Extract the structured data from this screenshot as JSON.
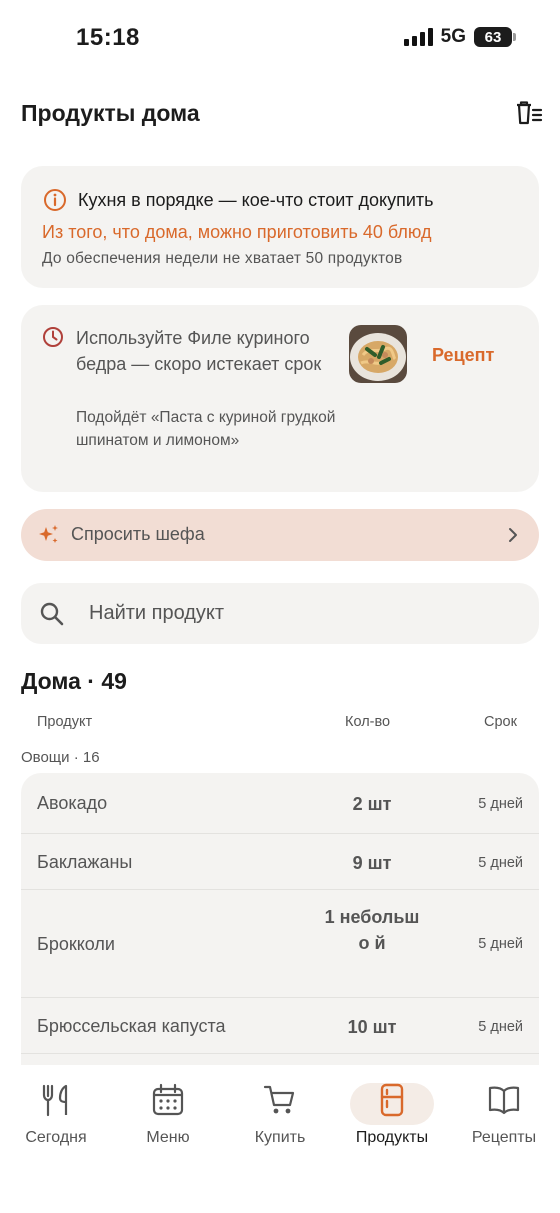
{
  "status_bar": {
    "time": "15:18",
    "network": "5G",
    "battery": "63"
  },
  "header": {
    "title": "Продукты дома",
    "clear_icon": "trash-list-icon"
  },
  "status_card": {
    "icon": "info-icon",
    "title": "Кухня в порядке — кое-что стоит докупить",
    "accent": "Из того, что дома, можно приготовить 40 блюд",
    "subtitle": "До обеспечения недели не хватает 50 продуктов"
  },
  "expire_card": {
    "icon": "clock-icon",
    "text": "Используйте Филе куриного бедра — скоро истекает срок",
    "hint": "Подойдёт «Паста с куриной грудкой шпинатом и лимоном»",
    "recipe_label": "Рецепт"
  },
  "ask_chef": {
    "label": "Спросить шефа",
    "icon": "sparkle-icon"
  },
  "search": {
    "placeholder": "Найти продукт"
  },
  "home": {
    "title": "Дома · 49",
    "columns": {
      "product": "Продукт",
      "qty": "Кол-во",
      "expires": "Срок"
    },
    "group_label": "Овощи · 16",
    "rows": [
      {
        "name": "Авокадо",
        "qty": "2 шт",
        "expires": "5 дней"
      },
      {
        "name": "Баклажаны",
        "qty": "9 шт",
        "expires": "5 дней"
      },
      {
        "name": "Брокколи",
        "qty": "1 небольшо й",
        "expires": "5 дней"
      },
      {
        "name": "Брюссельская капуста",
        "qty": "10 шт",
        "expires": "5 дней"
      }
    ]
  },
  "tabs": [
    {
      "label": "Сегодня",
      "icon": "fork-knife-icon",
      "active": false
    },
    {
      "label": "Меню",
      "icon": "calendar-icon",
      "active": false
    },
    {
      "label": "Купить",
      "icon": "cart-icon",
      "active": false
    },
    {
      "label": "Продукты",
      "icon": "fridge-icon",
      "active": true
    },
    {
      "label": "Рецепты",
      "icon": "book-icon",
      "active": false
    }
  ],
  "colors": {
    "accent": "#d9692b",
    "card_bg": "#f4f3f1",
    "ask_bg": "#f2ddd4",
    "clock": "#b0403a"
  }
}
